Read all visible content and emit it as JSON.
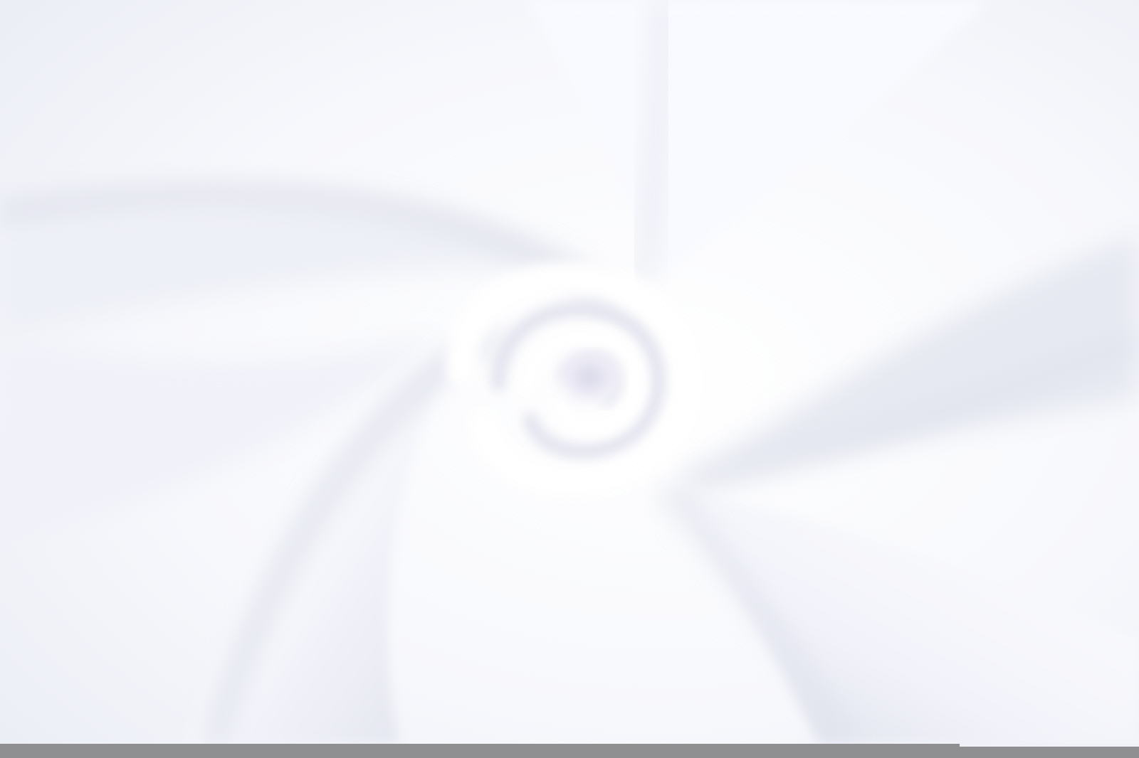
{
  "photo": {
    "subject": "white-fabric-swirl",
    "colors": {
      "base": "#f7f8fc",
      "highlight": "#ffffff",
      "shadow": "#dcdee8",
      "deep_shadow": "#cfd2df",
      "lavender_tint": "#e9e8f5",
      "strip": "#8f8f92"
    }
  }
}
